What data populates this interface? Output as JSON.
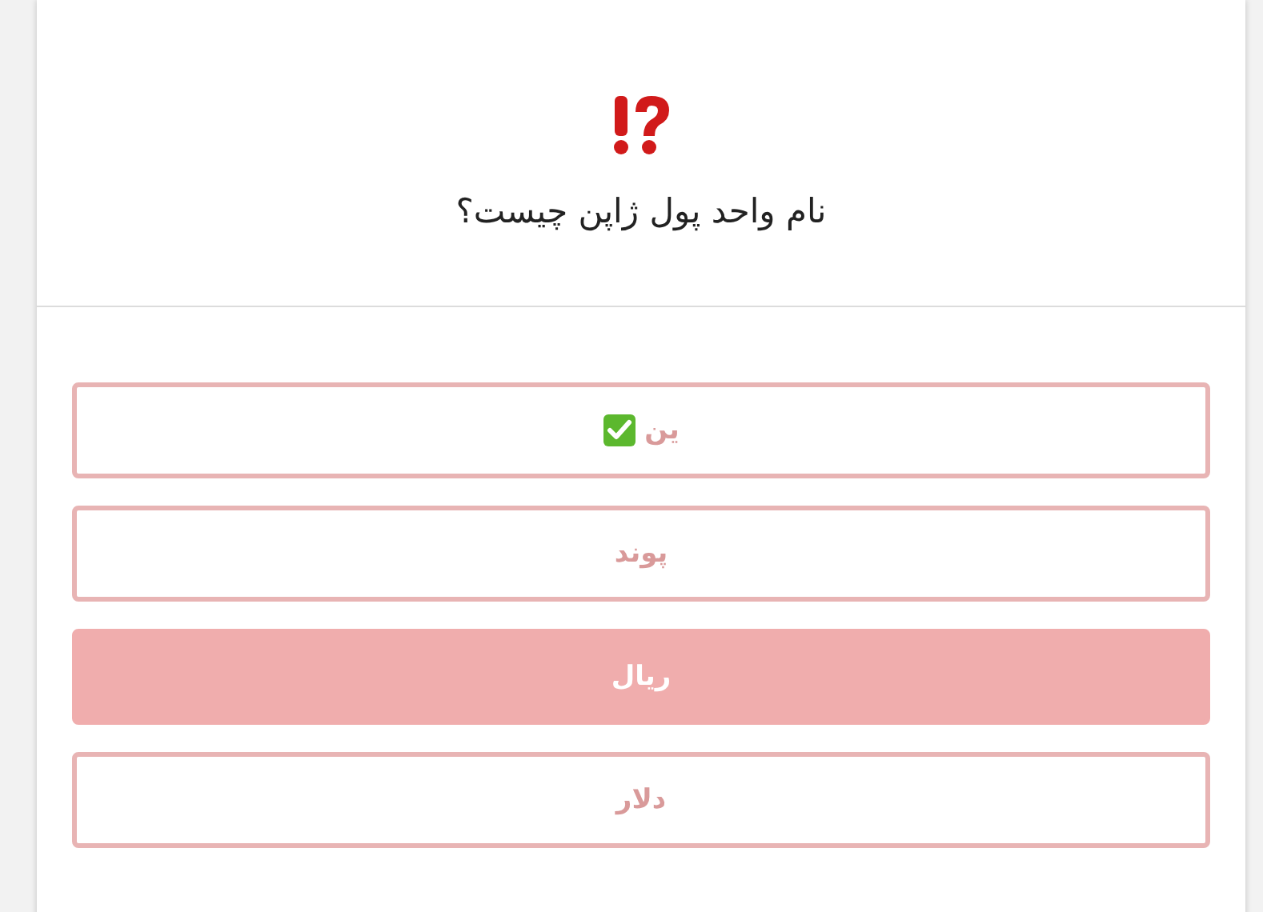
{
  "question": {
    "text": "نام واحد پول ژاپن چیست؟"
  },
  "options": [
    {
      "label": "ین",
      "correct": true,
      "selected": false
    },
    {
      "label": "پوند",
      "correct": false,
      "selected": false
    },
    {
      "label": "ریال",
      "correct": false,
      "selected": true
    },
    {
      "label": "دلار",
      "correct": false,
      "selected": false
    }
  ]
}
